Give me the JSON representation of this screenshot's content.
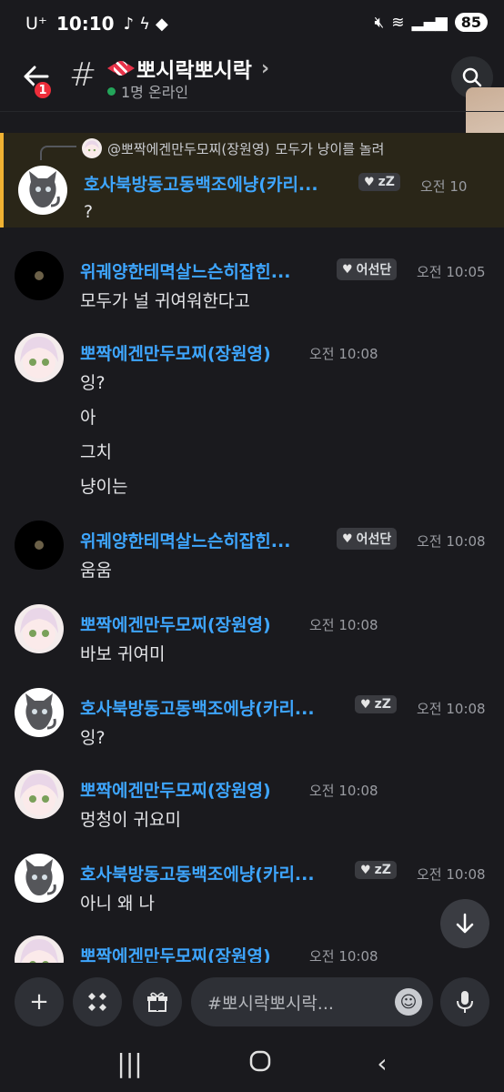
{
  "status_bar": {
    "carrier": "U⁺",
    "time": "10:10",
    "battery": "85"
  },
  "header": {
    "unread_count": "1",
    "channel_name": "뽀시락뽀시락",
    "online_text": "1명 온라인",
    "online_color": "#23a55a"
  },
  "messages": [
    {
      "reply_to": {
        "mention": "@뽀짝에겐만두모찌(장원영)",
        "text": "모두가 냥이를 놀려"
      },
      "author": "호사북방동고동백조에냥(카리...",
      "tag": "zZ",
      "time": "오전 10",
      "avatar": "cat",
      "lines": [
        "?"
      ]
    },
    {
      "author": "위궤양한테멱살느슨히잡힌...",
      "tag": "어선단",
      "time": "오전 10:05",
      "avatar": "moon",
      "lines": [
        "모두가 널 귀여워한다고"
      ]
    },
    {
      "author": "뽀짝에겐만두모찌(장원영)",
      "time": "오전 10:08",
      "avatar": "girl",
      "lines": [
        "잉?",
        "아",
        "그치",
        "냥이는"
      ]
    },
    {
      "author": "위궤양한테멱살느슨히잡힌...",
      "tag": "어선단",
      "time": "오전 10:08",
      "avatar": "moon",
      "lines": [
        "움움"
      ]
    },
    {
      "author": "뽀짝에겐만두모찌(장원영)",
      "time": "오전 10:08",
      "avatar": "girl",
      "lines": [
        "바보 귀여미"
      ]
    },
    {
      "author": "호사북방동고동백조에냥(카리...",
      "tag": "zZ",
      "time": "오전 10:08",
      "avatar": "cat",
      "lines": [
        "잉?"
      ]
    },
    {
      "author": "뽀짝에겐만두모찌(장원영)",
      "time": "오전 10:08",
      "avatar": "girl",
      "lines": [
        "멍청이 귀요미"
      ]
    },
    {
      "author": "호사북방동고동백조에냥(카리...",
      "tag": "zZ",
      "time": "오전 10:08",
      "avatar": "cat",
      "lines": [
        "아니 왜 나"
      ]
    },
    {
      "author": "뽀짝에겐만두모찌(장원영)",
      "time": "오전 10:08",
      "avatar": "girl",
      "lines": []
    }
  ],
  "composer": {
    "placeholder": "#뽀시락뽀시락..."
  },
  "colors": {
    "username": "#3ea6ff",
    "highlight_bar": "#f0b232",
    "badge": "#ee2d3a"
  }
}
